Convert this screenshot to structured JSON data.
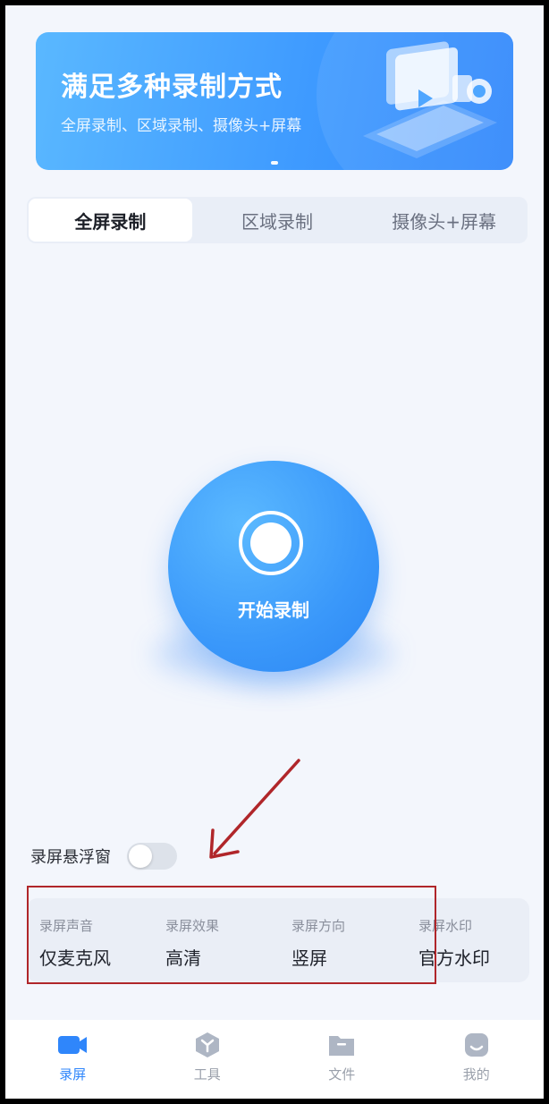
{
  "banner": {
    "title": "满足多种录制方式",
    "subtitle": "全屏录制、区域录制、摄像头+屏幕",
    "illustration_icon": "video-camera-illustration",
    "page_indicator": "slide 1 of 1"
  },
  "mode_tabs": [
    {
      "label": "全屏录制",
      "active": true
    },
    {
      "label": "区域录制",
      "active": false
    },
    {
      "label": "摄像头+屏幕",
      "active": false
    }
  ],
  "start_button": {
    "label": "开始录制",
    "icon": "record-icon"
  },
  "floating_window": {
    "label": "录屏悬浮窗",
    "enabled": false
  },
  "settings": [
    {
      "label": "录屏声音",
      "value": "仅麦克风"
    },
    {
      "label": "录屏效果",
      "value": "高清"
    },
    {
      "label": "录屏方向",
      "value": "竖屏"
    },
    {
      "label": "录屏水印",
      "value": "官方水印"
    }
  ],
  "bottom_nav": [
    {
      "label": "录屏",
      "icon": "video-camera-icon",
      "active": true
    },
    {
      "label": "工具",
      "icon": "toolbox-icon",
      "active": false
    },
    {
      "label": "文件",
      "icon": "folder-icon",
      "active": false
    },
    {
      "label": "我的",
      "icon": "profile-icon",
      "active": false
    }
  ],
  "colors": {
    "accent": "#2f86fb",
    "annotation": "#b0262a",
    "background": "#f3f6fc"
  }
}
